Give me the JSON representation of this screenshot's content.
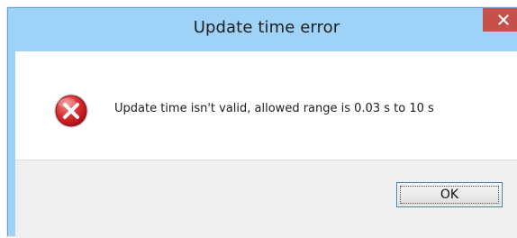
{
  "window": {
    "title": "Update time error"
  },
  "message": {
    "text": "Update time isn't valid, allowed range is 0.03 s to 10 s"
  },
  "buttons": {
    "ok_label": "OK"
  },
  "icons": {
    "close": "close-icon",
    "error": "error-icon"
  },
  "colors": {
    "titlebar": "#9fd2f7",
    "close_button": "#c7504d",
    "error_red": "#cf2028",
    "footer": "#f0f0f0"
  }
}
